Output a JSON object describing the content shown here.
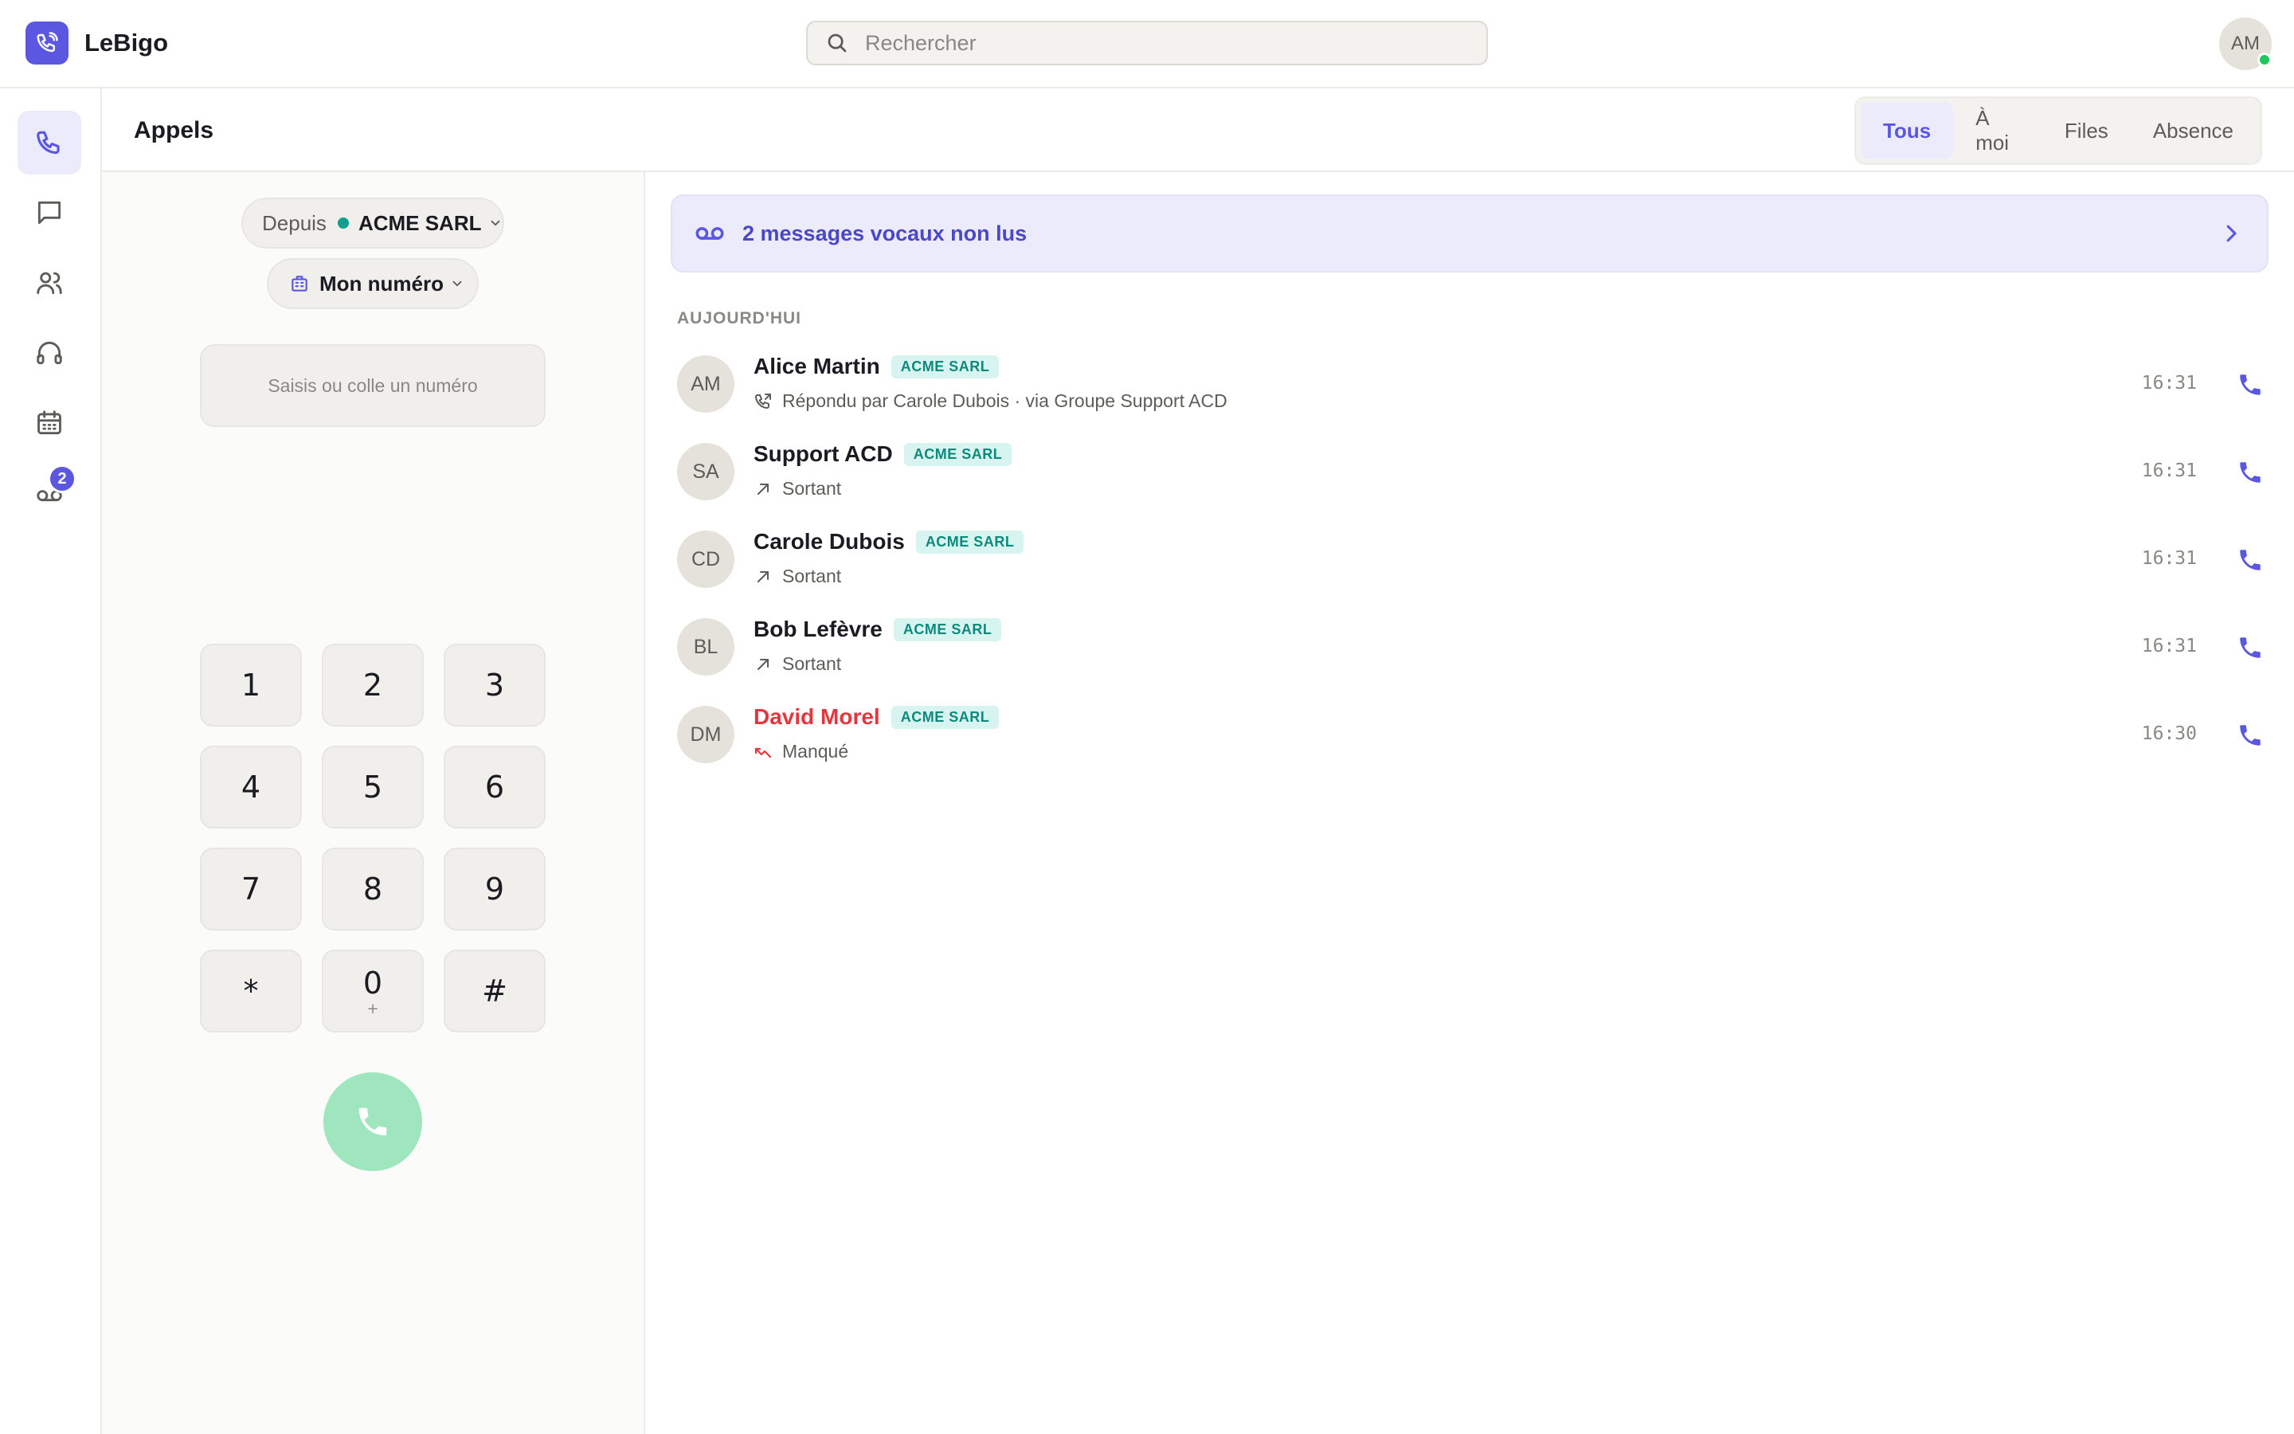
{
  "app": {
    "name": "LeBigo"
  },
  "search": {
    "placeholder": "Rechercher"
  },
  "user": {
    "initials": "AM"
  },
  "page": {
    "title": "Appels"
  },
  "filters": [
    {
      "label": "Tous",
      "active": true
    },
    {
      "label": "À moi",
      "active": false
    },
    {
      "label": "Files",
      "active": false
    },
    {
      "label": "Absence",
      "active": false
    }
  ],
  "nav": {
    "voicemail_badge": "2"
  },
  "dialer": {
    "from_label": "Depuis",
    "from_org": "ACME SARL",
    "number_label": "Mon numéro",
    "input_placeholder": "Saisis ou colle un numéro",
    "keys": [
      {
        "digit": "1",
        "sub": ""
      },
      {
        "digit": "2",
        "sub": ""
      },
      {
        "digit": "3",
        "sub": ""
      },
      {
        "digit": "4",
        "sub": ""
      },
      {
        "digit": "5",
        "sub": ""
      },
      {
        "digit": "6",
        "sub": ""
      },
      {
        "digit": "7",
        "sub": ""
      },
      {
        "digit": "8",
        "sub": ""
      },
      {
        "digit": "9",
        "sub": ""
      },
      {
        "digit": "*",
        "sub": ""
      },
      {
        "digit": "0",
        "sub": "+"
      },
      {
        "digit": "#",
        "sub": ""
      }
    ]
  },
  "voicemail": {
    "text": "2 messages vocaux non lus"
  },
  "calls": {
    "section": "AUJOURD'HUI",
    "items": [
      {
        "initials": "AM",
        "name": "Alice Martin",
        "tag": "ACME SARL",
        "detail": "Répondu par Carole Dubois · via Groupe Support ACD",
        "kind": "transferred",
        "time": "16:31",
        "missed": false
      },
      {
        "initials": "SA",
        "name": "Support ACD",
        "tag": "ACME SARL",
        "detail": "Sortant",
        "kind": "outgoing",
        "time": "16:31",
        "missed": false
      },
      {
        "initials": "CD",
        "name": "Carole Dubois",
        "tag": "ACME SARL",
        "detail": "Sortant",
        "kind": "outgoing",
        "time": "16:31",
        "missed": false
      },
      {
        "initials": "BL",
        "name": "Bob Lefèvre",
        "tag": "ACME SARL",
        "detail": "Sortant",
        "kind": "outgoing",
        "time": "16:31",
        "missed": false
      },
      {
        "initials": "DM",
        "name": "David Morel",
        "tag": "ACME SARL",
        "detail": "Manqué",
        "kind": "missed",
        "time": "16:30",
        "missed": true
      }
    ]
  },
  "colors": {
    "accent": "#5b57e0",
    "teal": "#0e9f8f",
    "missed": "#e0383e",
    "call_green": "#9fe6bf"
  }
}
